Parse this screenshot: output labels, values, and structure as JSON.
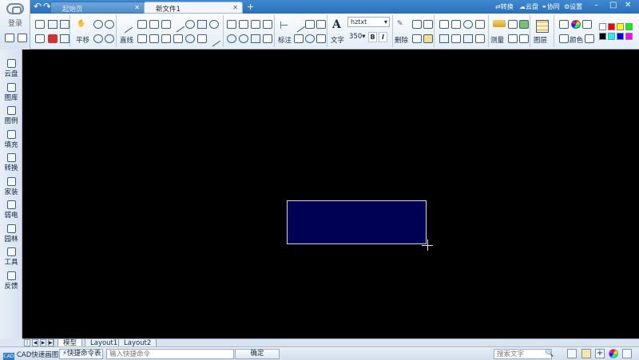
{
  "titlebar": {
    "login_label": "登录",
    "tabs": [
      {
        "label": "起始页",
        "active": false
      },
      {
        "label": "新文件1",
        "active": true
      }
    ],
    "add_tab": "+",
    "links": {
      "convert": "转换",
      "cloud": "云盘",
      "collab": "协同",
      "settings": "设置"
    },
    "window_buttons": {
      "minimize": "–",
      "maximize": "□",
      "close": "✕"
    }
  },
  "ribbon": {
    "pan_label": "平移",
    "line_label": "直线",
    "dim_label": "标注",
    "text_label": "文字",
    "font_value": "hztxt",
    "font_size": "350",
    "bold": "B",
    "italic": "I",
    "erase_label": "删除",
    "measure_label": "测量",
    "layer_label": "图层",
    "color_label": "颜色",
    "colors": [
      "#ffffff",
      "#ff0000",
      "#ffff00",
      "#00ff00",
      "#000000",
      "#00ffff",
      "#0000ff",
      "#ff00ff"
    ]
  },
  "sidebar": {
    "items": [
      {
        "label": "云盘",
        "icon": "cloud-icon"
      },
      {
        "label": "图库",
        "icon": "library-icon"
      },
      {
        "label": "图例",
        "icon": "legend-icon"
      },
      {
        "label": "填充",
        "icon": "hatch-icon"
      },
      {
        "label": "转换",
        "icon": "convert-icon"
      },
      {
        "label": "家装",
        "icon": "home-decor-icon"
      },
      {
        "label": "弱电",
        "icon": "low-voltage-icon"
      },
      {
        "label": "园林",
        "icon": "garden-icon"
      },
      {
        "label": "工具",
        "icon": "tools-icon"
      },
      {
        "label": "反馈",
        "icon": "feedback-icon"
      }
    ]
  },
  "canvas": {
    "background": "#000000",
    "shape_fill": "#000055"
  },
  "layout_tabs": [
    {
      "label": "模型",
      "active": true
    },
    {
      "label": "Layout1",
      "active": false
    },
    {
      "label": "Layout2",
      "active": false
    }
  ],
  "statusbar": {
    "brand": "CAD快速画图",
    "brand_badge": "CAD",
    "cmd_table": "⚡快捷命令表",
    "cmd_placeholder": "输入快捷命令",
    "ok_label": "确定",
    "search_placeholder": "搜索文字"
  }
}
